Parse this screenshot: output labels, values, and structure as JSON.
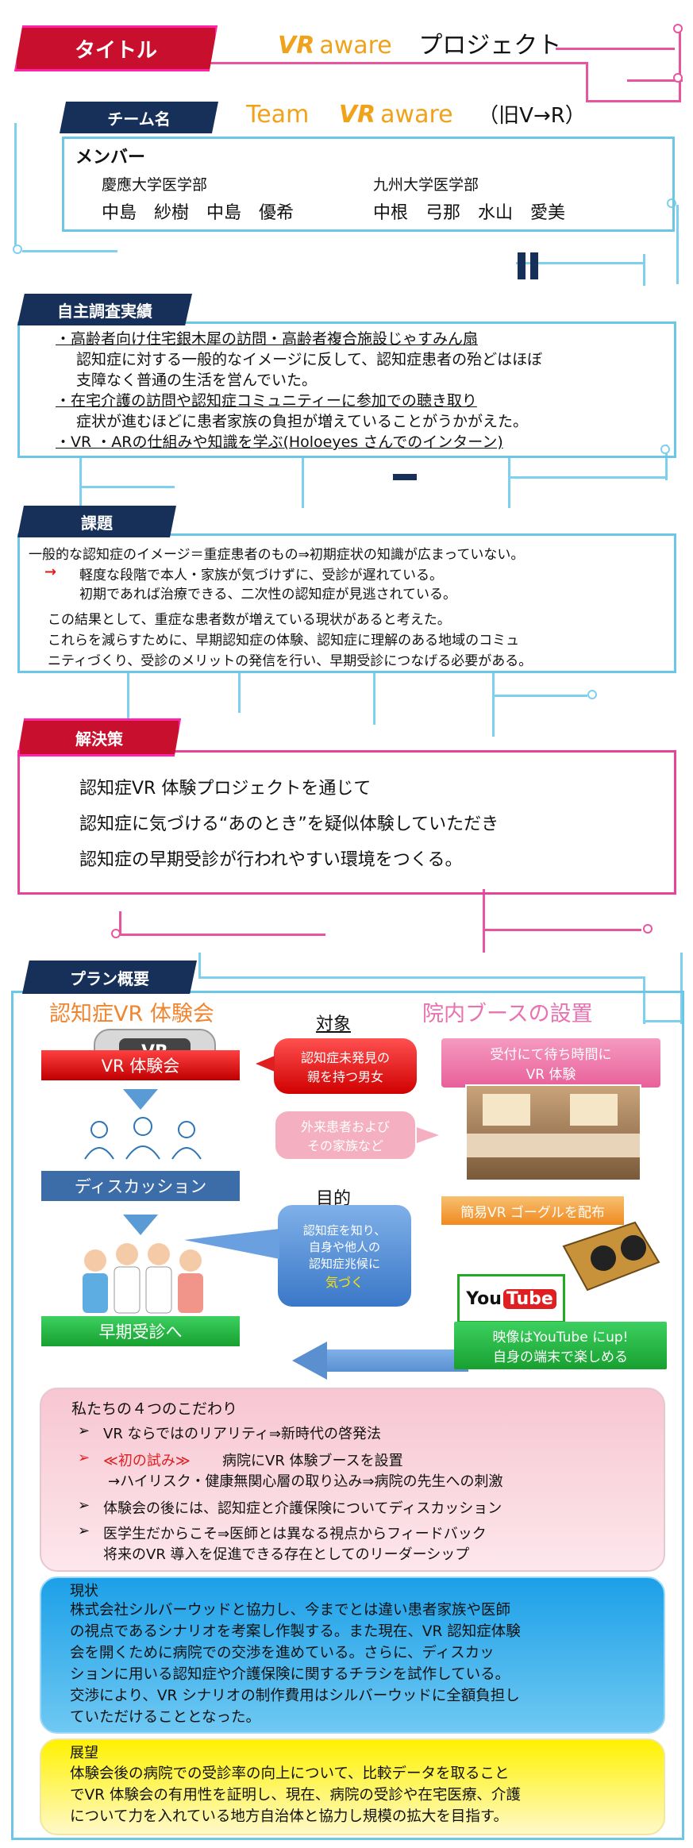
{
  "title_tag": "タイトル",
  "project": {
    "logo_vr": "VR",
    "logo_aware": "aware",
    "name": "プロジェクト"
  },
  "team": {
    "tag": "チーム名",
    "team_word": "Team",
    "logo_vr": "VR",
    "logo_aware": "aware",
    "old_name": "（旧V→R）",
    "members_label": "メンバー",
    "keio_school": "慶應大学医学部",
    "keio_members": "中島　紗樹　中島　優希",
    "kyushu_school": "九州大学医学部",
    "kyushu_members": "中根　弓那　水山　愛美"
  },
  "research": {
    "tag": "自主調査実績",
    "l1": "・高齢者向け住宅銀木犀の訪問・高齢者複合施設じゃすみん扇",
    "l2": "認知症に対する一般的なイメージに反して、認知症患者の殆どはほぼ",
    "l3": "支障なく普通の生活を営んでいた。",
    "l4": "・在宅介護の訪問や認知症コミュニティーに参加での聴き取り",
    "l5": "症状が進むほどに患者家族の負担が増えていることがうかがえた。",
    "l6": "・VR ・ARの仕組みや知識を学ぶ(Holoeyes さんでのインターン)"
  },
  "issue": {
    "tag": "課題",
    "l1": "一般的な認知症のイメージ＝重症患者のもの⇒初期症状の知識が広まっていない。",
    "arrow": "→",
    "l2": "軽度な段階で本人・家族が気づけずに、受診が遅れている。",
    "l3": "初期であれば治療できる、二次性の認知症が見逃されている。",
    "l4": "この結果として、重症な患者数が増えている現状があると考えた。",
    "l5": "これらを減らすために、早期認知症の体験、認知症に理解のある地域のコミュ",
    "l6": "ニティづくり、受診のメリットの発信を行い、早期受診につなげる必要がある。"
  },
  "solution": {
    "tag": "解決策",
    "l1": "認知症VR 体験プロジェクトを通じて",
    "l2": "認知症に気づける“あのとき”を疑似体験していただき",
    "l3": "認知症の早期受診が行われやすい環境をつくる。"
  },
  "plan": {
    "tag": "プラン概要",
    "left_title": "認知症VR 体験会",
    "right_title": "院内ブースの設置",
    "target_label": "対象",
    "purpose_label": "目的",
    "vr_event_button": "VR 体験会",
    "goggle_text": "VR",
    "target_red": "認知症未発見の\n親を持つ男女",
    "target_pink": "外来患者および\nその家族など",
    "discussion": "ディスカッション",
    "purpose_bubble": "認知症を知り、\n自身や他人の\n認知症兆候に",
    "purpose_notice": "気づく",
    "early_visit": "早期受診へ",
    "booth_caption": "受付にて待ち時間に\nVR 体験",
    "goggle_distribute": "簡易VR ゴーグルを配布",
    "youtube_logo_1": "You",
    "youtube_logo_2": "Tube",
    "youtube_caption": "映像はYouTube にup!\n自身の端末で楽しめる"
  },
  "commitment": {
    "title": "私たちの４つのこだわり",
    "i1": "VR ならではのリアリティ⇒新時代の啓発法",
    "i2_emph": "≪初の試み≫",
    "i2": "病院にVR 体験ブースを設置",
    "i2b": "→ハイリスク・健康無関心層の取り込み⇒病院の先生への刺激",
    "i3": "体験会の後には、認知症と介護保険についてディスカッション",
    "i4": "医学生だからこそ⇒医師とは異なる視点からフィードバック",
    "i4b": "将来のVR 導入を促進できる存在としてのリーダーシップ"
  },
  "current": {
    "title": "現状",
    "l1": "株式会社シルバーウッドと協力し、今までとは違い患者家族や医師",
    "l2": "の視点であるシナリオを考案し作製する。また現在、VR 認知症体験",
    "l3": "会を開くために病院での交渉を進めている。さらに、ディスカッ",
    "l4": "ションに用いる認知症や介護保険に関するチラシを試作している。",
    "l5": "交渉により、VR シナリオの制作費用はシルバーウッドに全額負担し",
    "l6": "ていただけることとなった。"
  },
  "outlook": {
    "title": "展望",
    "l1": "体験会後の病院での受診率の向上について、比較データを取ること",
    "l2": "でVR 体験会の有用性を証明し、現在、病院の受診や在宅医療、介護",
    "l3": "について力を入れている地方自治体と協力し規模の拡大を目指す。"
  },
  "colors": {
    "accent_red": "#c8102e",
    "accent_pink": "#e6439a",
    "accent_blue": "#6cc6e6",
    "navy": "#17305a"
  }
}
